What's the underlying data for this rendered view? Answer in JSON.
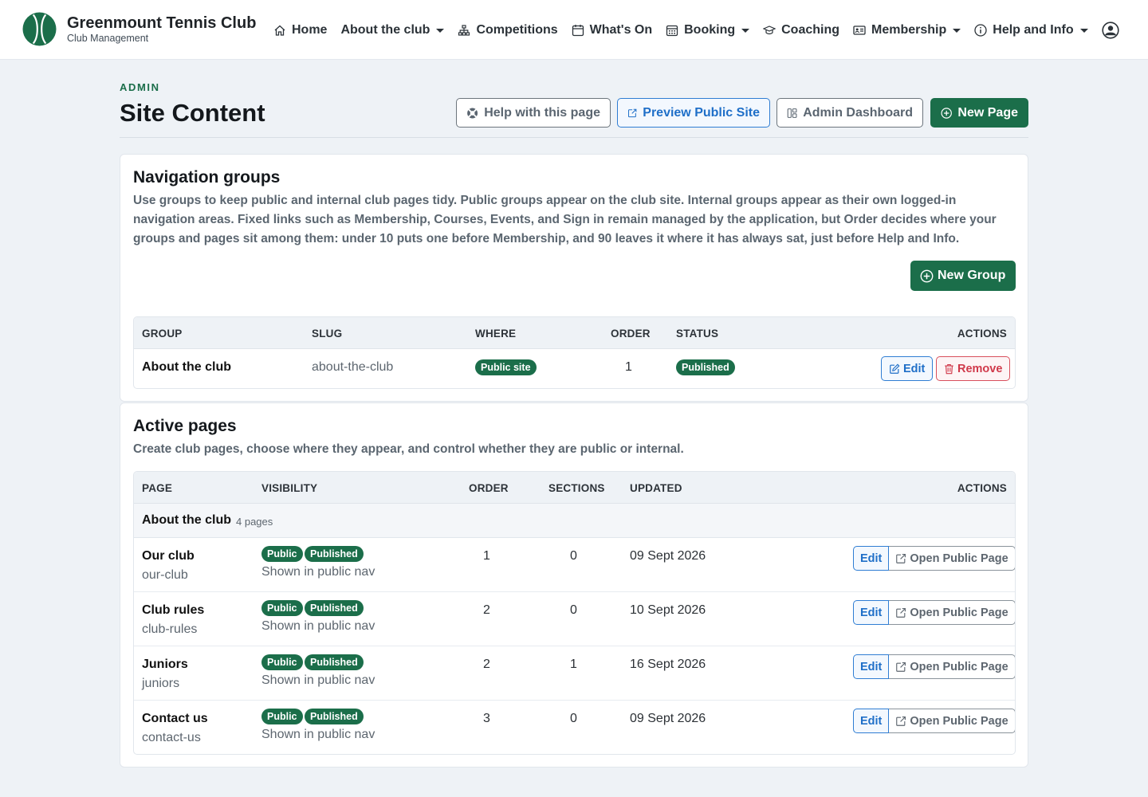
{
  "brand": {
    "name": "Greenmount Tennis Club",
    "subtitle": "Club Management"
  },
  "nav": [
    {
      "label": "Home",
      "icon": "home-icon",
      "dropdown": false
    },
    {
      "label": "About the club",
      "icon": "",
      "dropdown": true
    },
    {
      "label": "Competitions",
      "icon": "sitemap-icon",
      "dropdown": false
    },
    {
      "label": "What's On",
      "icon": "calendar-icon",
      "dropdown": false
    },
    {
      "label": "Booking",
      "icon": "grid-calendar-icon",
      "dropdown": true
    },
    {
      "label": "Coaching",
      "icon": "mortarboard-icon",
      "dropdown": false
    },
    {
      "label": "Membership",
      "icon": "id-card-icon",
      "dropdown": true
    },
    {
      "label": "Help and Info",
      "icon": "info-circle-icon",
      "dropdown": true
    }
  ],
  "header": {
    "eyebrow": "ADMIN",
    "title": "Site Content",
    "buttons": {
      "help": "Help with this page",
      "preview": "Preview Public Site",
      "dashboard": "Admin Dashboard",
      "new_page": "New Page"
    }
  },
  "nav_groups": {
    "title": "Navigation groups",
    "description": "Use groups to keep public and internal club pages tidy. Public groups appear on the club site. Internal groups appear as their own logged-in navigation areas. Fixed links such as Membership, Courses, Events, and Sign in remain managed by the application, but Order decides where your groups and pages sit among them: under 10 puts one before Membership, and 90 leaves it where it has always sat, just before Help and Info.",
    "new_group_label": "New Group",
    "columns": {
      "group": "GROUP",
      "slug": "SLUG",
      "where": "WHERE",
      "order": "ORDER",
      "status": "STATUS",
      "actions": "ACTIONS"
    },
    "rows": [
      {
        "group": "About the club",
        "slug": "about-the-club",
        "where": "Public site",
        "order": "1",
        "status": "Published",
        "edit": "Edit",
        "remove": "Remove"
      }
    ]
  },
  "active_pages": {
    "title": "Active pages",
    "description": "Create club pages, choose where they appear, and control whether they are public or internal.",
    "columns": {
      "page": "PAGE",
      "visibility": "VISIBILITY",
      "order": "ORDER",
      "sections": "SECTIONS",
      "updated": "UPDATED",
      "actions": "ACTIONS"
    },
    "group_heading": {
      "name": "About the club",
      "count": "4 pages"
    },
    "rows": [
      {
        "title": "Our club",
        "slug": "our-club",
        "badge1": "Public",
        "badge2": "Published",
        "note": "Shown in public nav",
        "order": "1",
        "sections": "0",
        "updated": "09 Sept 2026",
        "edit": "Edit",
        "open": "Open Public Page"
      },
      {
        "title": "Club rules",
        "slug": "club-rules",
        "badge1": "Public",
        "badge2": "Published",
        "note": "Shown in public nav",
        "order": "2",
        "sections": "0",
        "updated": "10 Sept 2026",
        "edit": "Edit",
        "open": "Open Public Page"
      },
      {
        "title": "Juniors",
        "slug": "juniors",
        "badge1": "Public",
        "badge2": "Published",
        "note": "Shown in public nav",
        "order": "2",
        "sections": "1",
        "updated": "16 Sept 2026",
        "edit": "Edit",
        "open": "Open Public Page"
      },
      {
        "title": "Contact us",
        "slug": "contact-us",
        "badge1": "Public",
        "badge2": "Published",
        "note": "Shown in public nav",
        "order": "3",
        "sections": "0",
        "updated": "09 Sept 2026",
        "edit": "Edit",
        "open": "Open Public Page"
      }
    ]
  },
  "colors": {
    "brand_green": "#1b6e4a",
    "link_blue": "#1f6fc8",
    "danger_red": "#d0394a",
    "page_bg": "#eef2f6"
  }
}
